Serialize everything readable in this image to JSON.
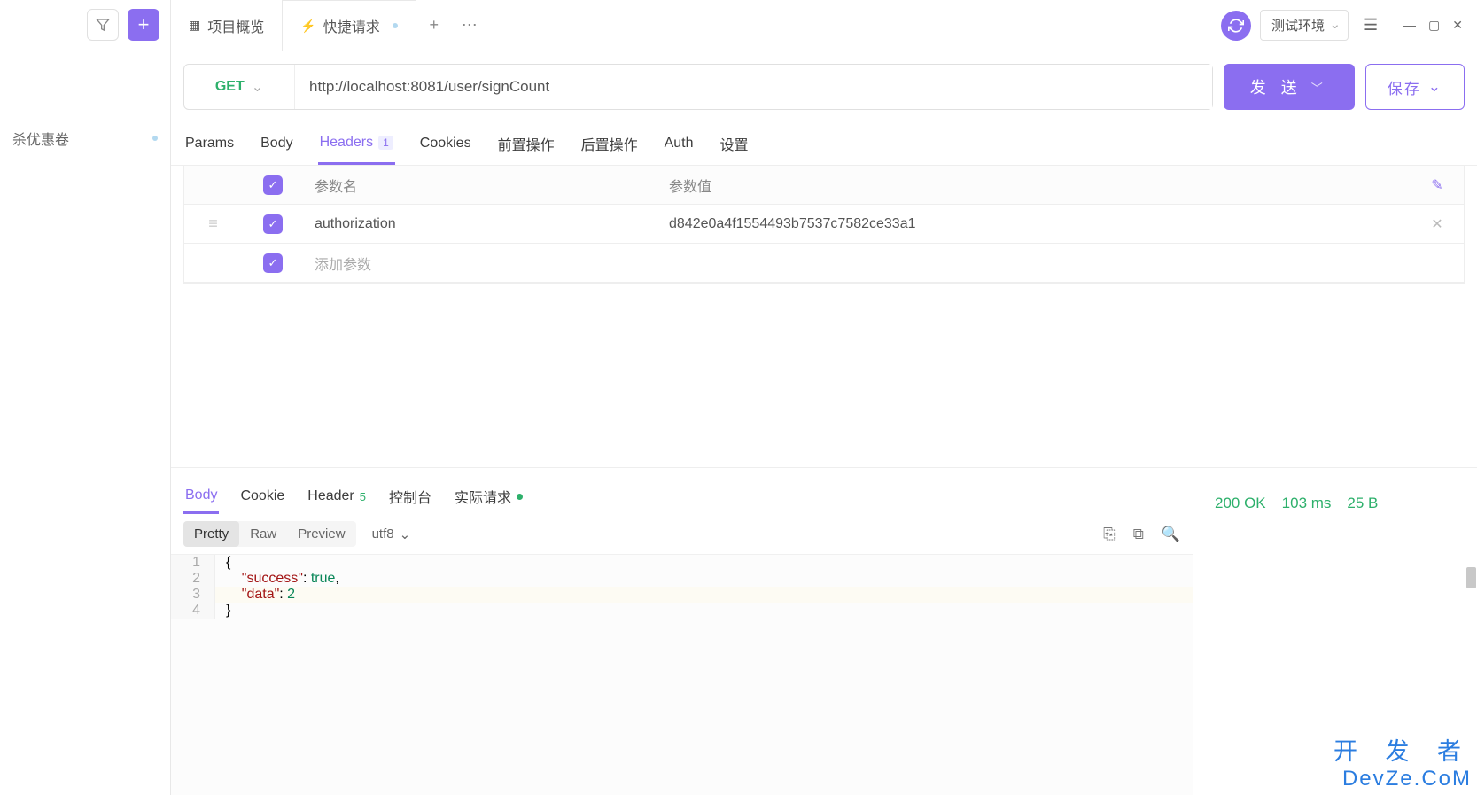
{
  "sidebar": {
    "items": [
      {
        "label": "杀优惠卷"
      }
    ]
  },
  "topTabs": {
    "tab1_label": "项目概览",
    "tab2_label": "快捷请求"
  },
  "env": {
    "label": "测试环境"
  },
  "request": {
    "method": "GET",
    "url": "http://localhost:8081/user/signCount",
    "send_label": "发 送",
    "save_label": "保存"
  },
  "reqTabs": {
    "params": "Params",
    "body": "Body",
    "headers": "Headers",
    "headers_count": "1",
    "cookies": "Cookies",
    "pre": "前置操作",
    "post": "后置操作",
    "auth": "Auth",
    "settings": "设置"
  },
  "headerTable": {
    "col_name": "参数名",
    "col_value": "参数值",
    "rows": [
      {
        "name": "authorization",
        "value": "d842e0a4f1554493b7537c7582ce33a1"
      }
    ],
    "add_placeholder": "添加参数"
  },
  "responseTabs": {
    "body": "Body",
    "cookie": "Cookie",
    "header": "Header",
    "header_count": "5",
    "console": "控制台",
    "actual": "实际请求"
  },
  "viewModes": {
    "pretty": "Pretty",
    "raw": "Raw",
    "preview": "Preview"
  },
  "encoding": "utf8",
  "responseJson": {
    "lines": [
      {
        "n": "1",
        "code": "{"
      },
      {
        "n": "2",
        "code": "    \"success\": true,",
        "hl": false
      },
      {
        "n": "3",
        "code": "    \"data\": 2",
        "hl": true
      },
      {
        "n": "4",
        "code": "}"
      }
    ]
  },
  "status": {
    "code": "200 OK",
    "time": "103 ms",
    "size": "25 B"
  },
  "watermark": {
    "l1": "开 发 者",
    "l2": "DevZe.CoM"
  }
}
